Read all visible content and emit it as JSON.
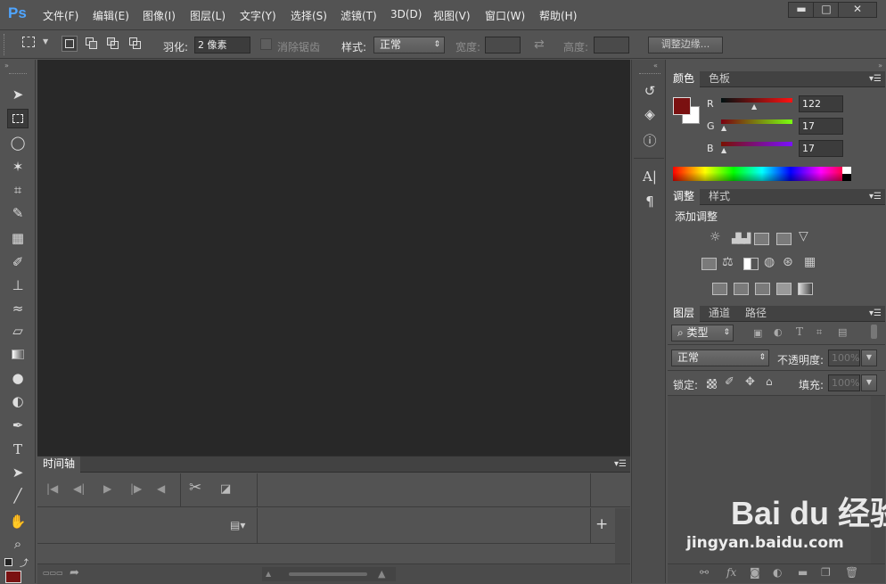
{
  "app": {
    "logo": "Ps"
  },
  "menu": [
    "文件(F)",
    "编辑(E)",
    "图像(I)",
    "图层(L)",
    "文字(Y)",
    "选择(S)",
    "滤镜(T)",
    "3D(D)",
    "视图(V)",
    "窗口(W)",
    "帮助(H)"
  ],
  "window_controls": {
    "minimize": "▬",
    "maximize": "□",
    "close": "✕"
  },
  "options": {
    "feather_label": "羽化:",
    "feather_value": "2 像素",
    "antialias_label": "消除锯齿",
    "style_label": "样式:",
    "style_value": "正常",
    "width_label": "宽度:",
    "swap_icon": "⇄",
    "height_label": "高度:",
    "refine_edge_button": "调整边缘..."
  },
  "timeline": {
    "tab": "时间轴",
    "add": "+"
  },
  "color_panel": {
    "tabs": [
      "颜色",
      "色板"
    ],
    "channels": [
      {
        "label": "R",
        "value": "122"
      },
      {
        "label": "G",
        "value": "17"
      },
      {
        "label": "B",
        "value": "17"
      }
    ],
    "foreground_color": "#7a1111",
    "background_color": "#ffffff",
    "channel_levels": [
      0.478,
      0.067,
      0.067
    ]
  },
  "adjustments_panel": {
    "tabs": [
      "调整",
      "样式"
    ],
    "title": "添加调整"
  },
  "layers_panel": {
    "tabs": [
      "图层",
      "通道",
      "路径"
    ],
    "filter_kind": "类型",
    "blend_mode": "正常",
    "opacity_label": "不透明度:",
    "opacity_value": "100%",
    "lock_label": "锁定:",
    "fill_label": "填充:",
    "fill_value": "100%"
  },
  "watermark": {
    "brand": "Bai du 经验",
    "url": "jingyan.baidu.com"
  }
}
